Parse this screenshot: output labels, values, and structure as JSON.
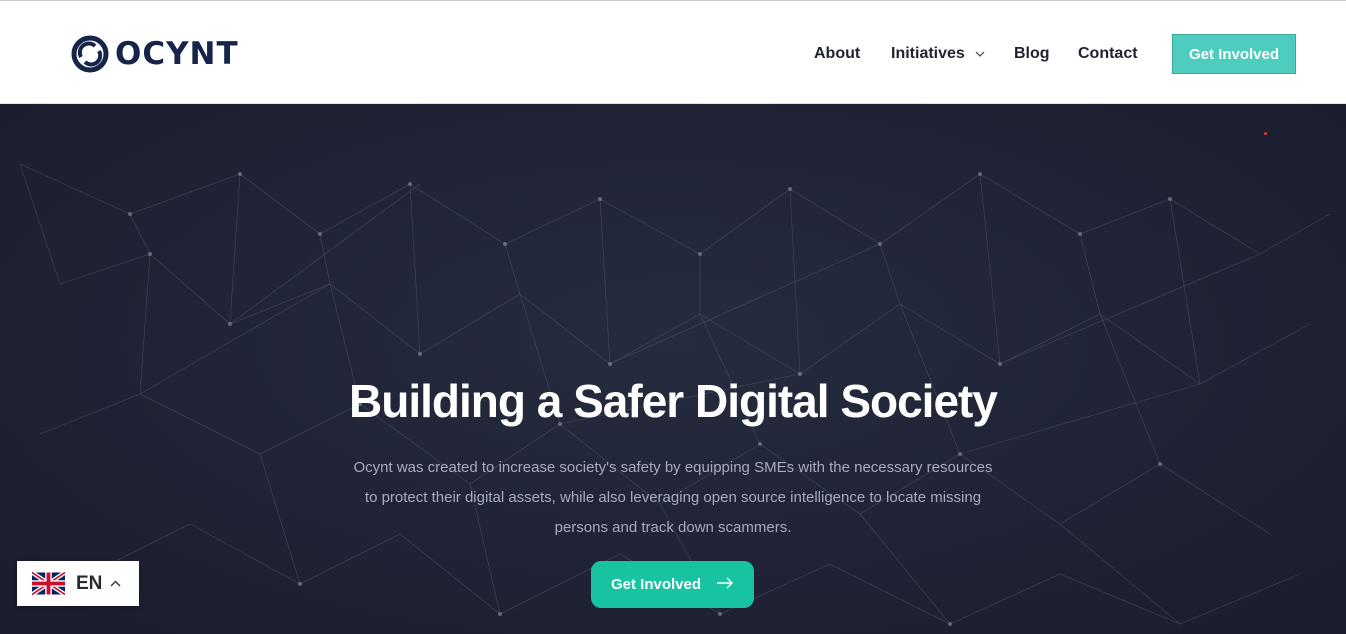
{
  "brand": {
    "name": "OCYNT",
    "color": "#16244a"
  },
  "nav": {
    "items": [
      {
        "label": "About"
      },
      {
        "label": "Initiatives"
      },
      {
        "label": "Blog"
      },
      {
        "label": "Contact"
      }
    ],
    "cta": "Get Involved"
  },
  "hero": {
    "title": "Building a Safer Digital Society",
    "description": "Ocynt was created to increase society's safety by  equipping SMEs with the necessary resources to protect their digital assets, while also leveraging open source intelligence to locate missing persons and track down scammers.",
    "cta": "Get Involved",
    "cta_icon": "arrow-right-icon"
  },
  "language": {
    "code": "EN",
    "flag": "uk-flag-icon",
    "caret": "chevron-up-icon"
  },
  "colors": {
    "accent": "#17c3a1",
    "header_cta": "#4ecdbf",
    "hero_bg": "#1f2335"
  }
}
